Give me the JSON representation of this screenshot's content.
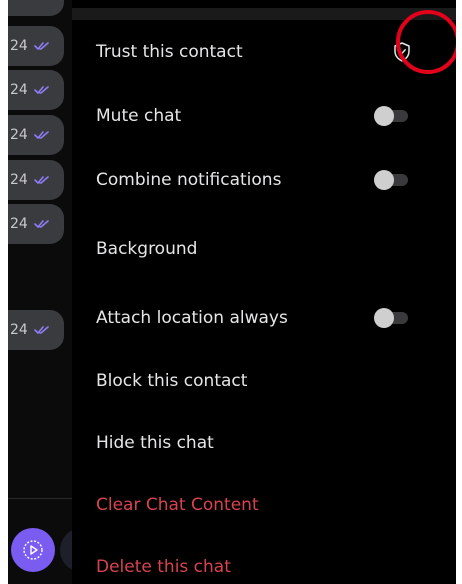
{
  "chat_list": {
    "bubbles": [
      {
        "time": "24"
      },
      {
        "time": "24"
      },
      {
        "time": "24"
      },
      {
        "time": "24"
      },
      {
        "time": "24"
      },
      {
        "time": "24"
      }
    ]
  },
  "menu": {
    "trust_contact": "Trust this contact",
    "mute_chat": "Mute chat",
    "combine_notifications": "Combine notifications",
    "background": "Background",
    "attach_location": "Attach location always",
    "block_contact": "Block this contact",
    "hide_chat": "Hide this chat",
    "clear_chat": "Clear Chat Content",
    "delete_chat": "Delete this chat"
  },
  "colors": {
    "background": "#000000",
    "text": "#e6e6e8",
    "danger": "#d9434e",
    "accent": "#7b5cf0",
    "tick": "#8c7df6",
    "highlight": "#e3001b"
  },
  "icons": {
    "trust": "shield-check-icon",
    "fab": "play-icon",
    "read": "double-check-icon"
  }
}
